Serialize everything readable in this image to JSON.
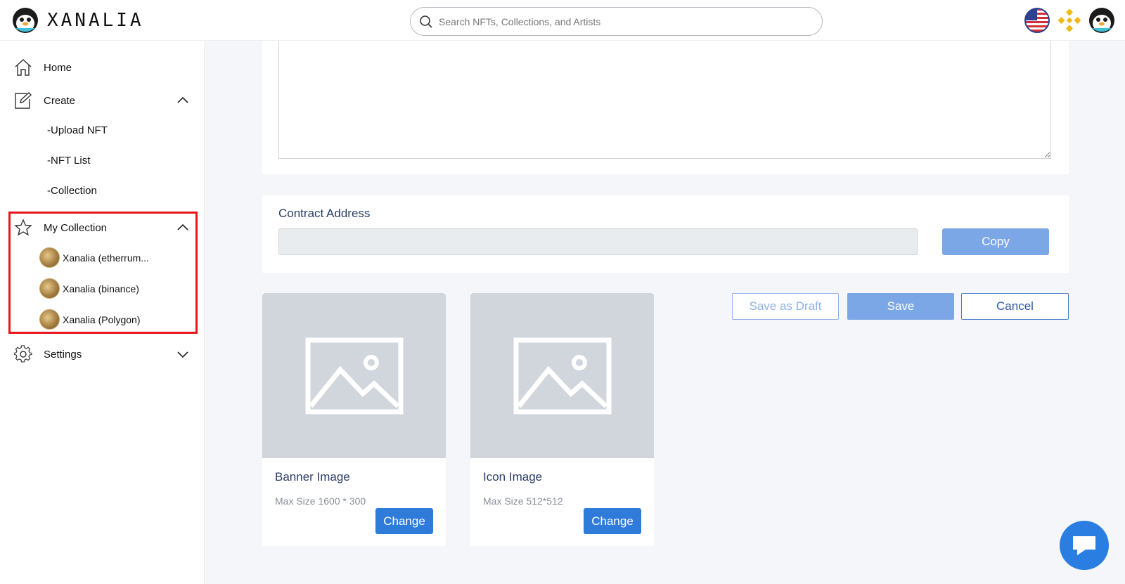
{
  "app": {
    "logo_text": "XANALIA"
  },
  "search": {
    "placeholder": "Search NFTs, Collections, and Artists"
  },
  "header_icons": [
    "us-flag-icon",
    "binance-icon",
    "profile-avatar-icon"
  ],
  "sidebar": {
    "home": "Home",
    "create": "Create",
    "create_items": [
      "-Upload NFT",
      "-NFT List",
      "-Collection"
    ],
    "my_collection": "My Collection",
    "collections": [
      "Xanalia (etherrum...",
      "Xanalia (binance)",
      "Xanalia (Polygon)"
    ],
    "settings": "Settings"
  },
  "contract": {
    "title": "Contract Address",
    "value": "",
    "copy_label": "Copy"
  },
  "actions": {
    "draft": "Save as Draft",
    "save": "Save",
    "cancel": "Cancel"
  },
  "banner": {
    "title": "Banner Image",
    "subtitle": "Max Size 1600 * 300",
    "button": "Change"
  },
  "icon_image": {
    "title": "Icon Image",
    "subtitle": "Max Size 512*512",
    "button": "Change"
  },
  "colors": {
    "accent": "#2f7bd9",
    "accent_light": "#7ba7e6",
    "highlight": "#e5161c",
    "title_text": "#2c3d66"
  }
}
